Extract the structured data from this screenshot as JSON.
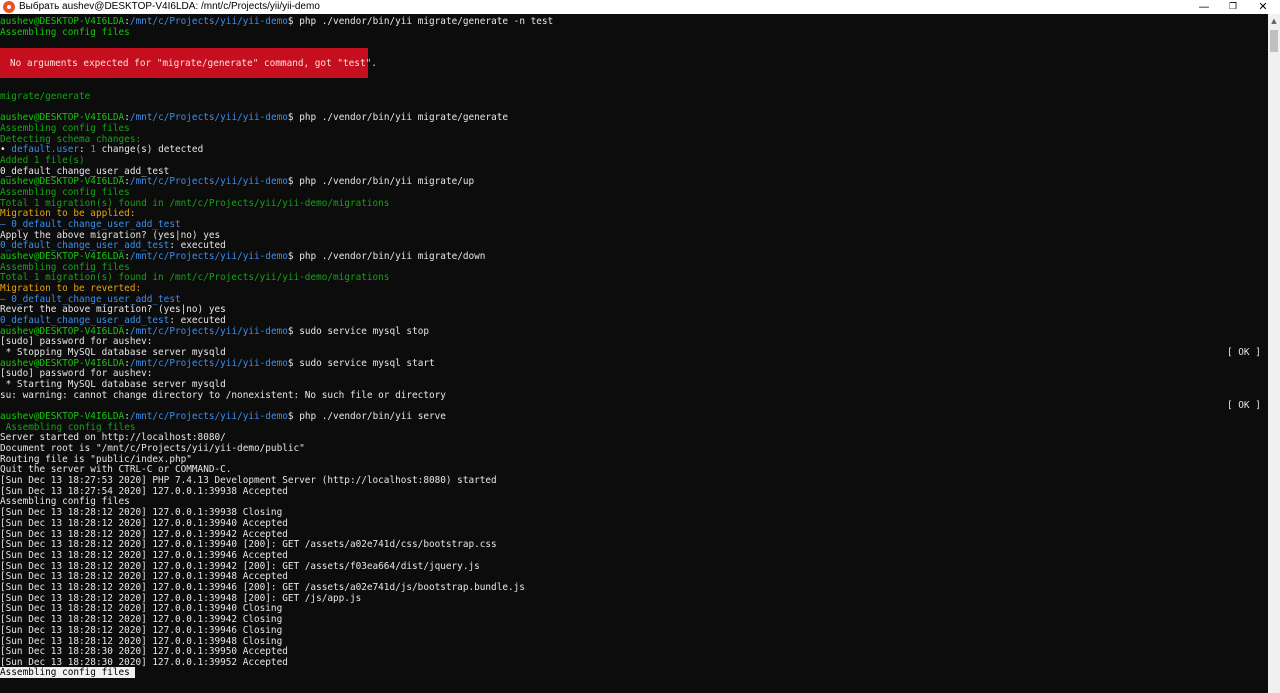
{
  "window": {
    "title": "Выбрать aushev@DESKTOP-V4I6LDA: /mnt/c/Projects/yii/yii-demo",
    "minimize": "—",
    "maximize": "❐",
    "close": "✕",
    "icon": "ubuntu-icon"
  },
  "prompt": {
    "user_host": "aushev@DESKTOP-V4I6LDA",
    "path": "/mnt/c/Projects/yii/yii-demo",
    "dollar": "$"
  },
  "error_message": "No arguments expected for \"migrate/generate\" command, got \"test\".",
  "ok_label": "[ OK ]",
  "commands": {
    "c1": " php ./vendor/bin/yii migrate/generate -n test",
    "c2": " php ./vendor/bin/yii migrate/generate",
    "c3": " php ./vendor/bin/yii migrate/up",
    "c4": " php ./vendor/bin/yii migrate/down",
    "c5": " sudo service mysql stop",
    "c6": " sudo service mysql start",
    "c7": " php ./vendor/bin/yii serve"
  },
  "output": {
    "assembling": "Assembling config files",
    "assembling_indent": " Assembling config files",
    "generate_label": "migrate/generate",
    "detecting": "Detecting schema changes:",
    "bullet": "• ",
    "default_user": "default.user",
    "change_count": "1",
    "changes_detected": " change(s) detected",
    "added": "Added 1 file(s)",
    "migration_name": "0_default_change_user_add_test",
    "total_found": "Total 1 migration(s) found in /mnt/c/Projects/yii/yii-demo/migrations",
    "to_be_applied": "Migration to be applied:",
    "dash_migration": "— 0_default_change_user_add_test",
    "apply_question": "Apply the above migration? (yes|no) yes",
    "executed": ": executed",
    "to_be_reverted": "Migration to be reverted:",
    "revert_question": "Revert the above migration? (yes|no) yes",
    "sudo_password": "[sudo] password for aushev:",
    "stopping": " * Stopping MySQL database server mysqld",
    "starting": " * Starting MySQL database server mysqld",
    "su_warning": "su: warning: cannot change directory to /nonexistent: No such file or directory",
    "server_started": "Server started on http://localhost:8080/",
    "doc_root": "Document root is \"/mnt/c/Projects/yii/yii-demo/public\"",
    "routing": "Routing file is \"public/index.php\"",
    "quit": "Quit the server with CTRL-C or COMMAND-C.",
    "assembling_cursor": "Assembling config files "
  },
  "server_log": [
    "[Sun Dec 13 18:27:53 2020] PHP 7.4.13 Development Server (http://localhost:8080) started",
    "[Sun Dec 13 18:27:54 2020] 127.0.0.1:39938 Accepted",
    "Assembling config files",
    "[Sun Dec 13 18:28:12 2020] 127.0.0.1:39938 Closing",
    "[Sun Dec 13 18:28:12 2020] 127.0.0.1:39940 Accepted",
    "[Sun Dec 13 18:28:12 2020] 127.0.0.1:39942 Accepted",
    "[Sun Dec 13 18:28:12 2020] 127.0.0.1:39940 [200]: GET /assets/a02e741d/css/bootstrap.css",
    "[Sun Dec 13 18:28:12 2020] 127.0.0.1:39946 Accepted",
    "[Sun Dec 13 18:28:12 2020] 127.0.0.1:39942 [200]: GET /assets/f03ea664/dist/jquery.js",
    "[Sun Dec 13 18:28:12 2020] 127.0.0.1:39948 Accepted",
    "[Sun Dec 13 18:28:12 2020] 127.0.0.1:39946 [200]: GET /assets/a02e741d/js/bootstrap.bundle.js",
    "[Sun Dec 13 18:28:12 2020] 127.0.0.1:39948 [200]: GET /js/app.js",
    "[Sun Dec 13 18:28:12 2020] 127.0.0.1:39940 Closing",
    "[Sun Dec 13 18:28:12 2020] 127.0.0.1:39942 Closing",
    "[Sun Dec 13 18:28:12 2020] 127.0.0.1:39946 Closing",
    "[Sun Dec 13 18:28:12 2020] 127.0.0.1:39948 Closing",
    "[Sun Dec 13 18:28:30 2020] 127.0.0.1:39950 Accepted",
    "[Sun Dec 13 18:28:30 2020] 127.0.0.1:39952 Accepted"
  ],
  "colors": {
    "background": "#0c0c0c",
    "prompt_green": "#16c60c",
    "path_blue": "#3b8eea",
    "warning_yellow": "#e5a50a",
    "error_red": "#c50f1f"
  }
}
